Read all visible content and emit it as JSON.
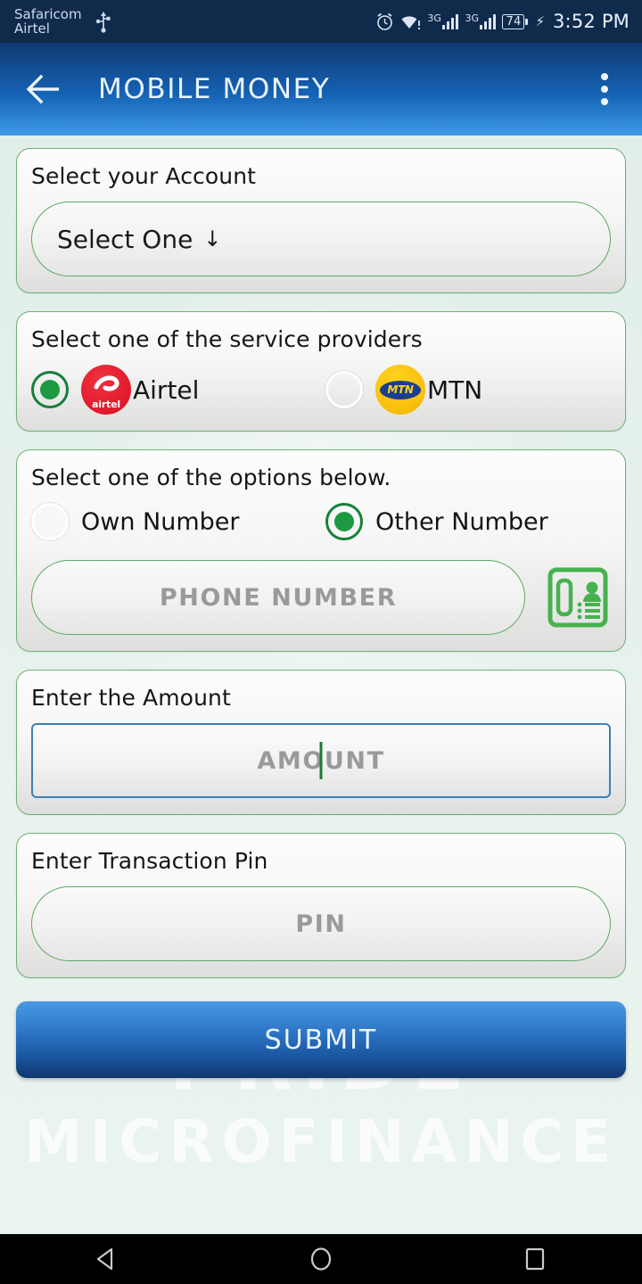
{
  "status_bar": {
    "carrier_primary": "Safaricom",
    "carrier_secondary": "Airtel",
    "usb_icon": "usb-icon",
    "alarm_icon": "alarm-clock-icon",
    "wifi_icon": "wifi-warning-icon",
    "network_1_label": "3G",
    "network_2_label": "3G",
    "battery_level": "74",
    "charging_icon": "charging-bolt-icon",
    "time": "3:52 PM"
  },
  "app_bar": {
    "back_icon": "back-arrow-icon",
    "title": "MOBILE MONEY",
    "overflow_icon": "overflow-menu-icon"
  },
  "background": {
    "watermark_line1": "PRIDE",
    "watermark_line2": "MICROFINANCE"
  },
  "account_card": {
    "label": "Select your Account",
    "dropdown_value": "Select One",
    "dropdown_arrow": "↓"
  },
  "provider_card": {
    "label": "Select one of the service providers",
    "options": [
      {
        "name": "Airtel",
        "selected": true,
        "logo_icon": "airtel-logo-icon",
        "logo_word": "airtel"
      },
      {
        "name": "MTN",
        "selected": false,
        "logo_icon": "mtn-logo-icon",
        "logo_word": "MTN"
      }
    ]
  },
  "number_card": {
    "label": "Select one of the options below.",
    "options": [
      {
        "name": "Own Number",
        "selected": false
      },
      {
        "name": "Other Number",
        "selected": true
      }
    ],
    "phone_placeholder": "PHONE NUMBER",
    "phone_value": "",
    "contacts_icon": "contacts-book-icon"
  },
  "amount_card": {
    "label": "Enter the Amount",
    "placeholder": "AMOUNT",
    "value": "",
    "focused": true
  },
  "pin_card": {
    "label": "Enter Transaction Pin",
    "placeholder": "PIN",
    "value": ""
  },
  "submit": {
    "label": "SUBMIT"
  },
  "nav_bar": {
    "back_icon": "nav-back-icon",
    "home_icon": "nav-home-icon",
    "recents_icon": "nav-recents-icon"
  },
  "colors": {
    "app_bar_blue": "#1562b4",
    "accent_green": "#1d9a41",
    "border_green": "#5ea863",
    "focus_blue": "#3d7fb5",
    "status_bar_navy": "#102a4c",
    "page_background": "#e4efec"
  }
}
